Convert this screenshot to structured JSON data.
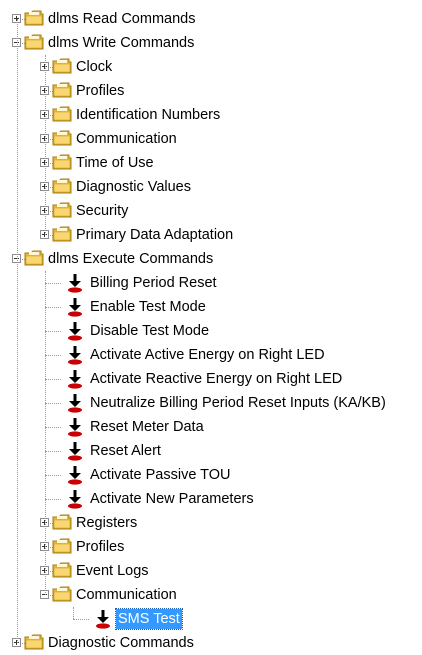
{
  "tree": {
    "read_commands": "dlms Read Commands",
    "write_commands": {
      "label": "dlms Write Commands",
      "children": [
        "Clock",
        "Profiles",
        "Identification Numbers",
        "Communication",
        "Time of Use",
        "Diagnostic Values",
        "Security",
        "Primary Data Adaptation"
      ]
    },
    "execute_commands": {
      "label": "dlms Execute Commands",
      "commands": [
        "Billing Period Reset",
        "Enable Test Mode",
        "Disable Test Mode",
        "Activate Active Energy on Right LED",
        "Activate Reactive Energy on Right LED",
        "Neutralize Billing Period Reset Inputs (KA/KB)",
        "Reset Meter Data",
        "Reset Alert",
        "Activate Passive TOU",
        "Activate New Parameters"
      ],
      "folders": [
        "Registers",
        "Profiles",
        "Event Logs"
      ],
      "communication": {
        "label": "Communication",
        "selected_child": "SMS Test"
      }
    },
    "diagnostic_commands": "Diagnostic Commands"
  },
  "colors": {
    "selection": "#3399ff",
    "folder": "#f2c94c",
    "command_arrow": "#000000",
    "command_base": "#cc0000"
  },
  "icons": {
    "folder": "folder-icon",
    "command": "execute-command-icon",
    "expand": "expand-plus-icon",
    "collapse": "collapse-minus-icon"
  }
}
